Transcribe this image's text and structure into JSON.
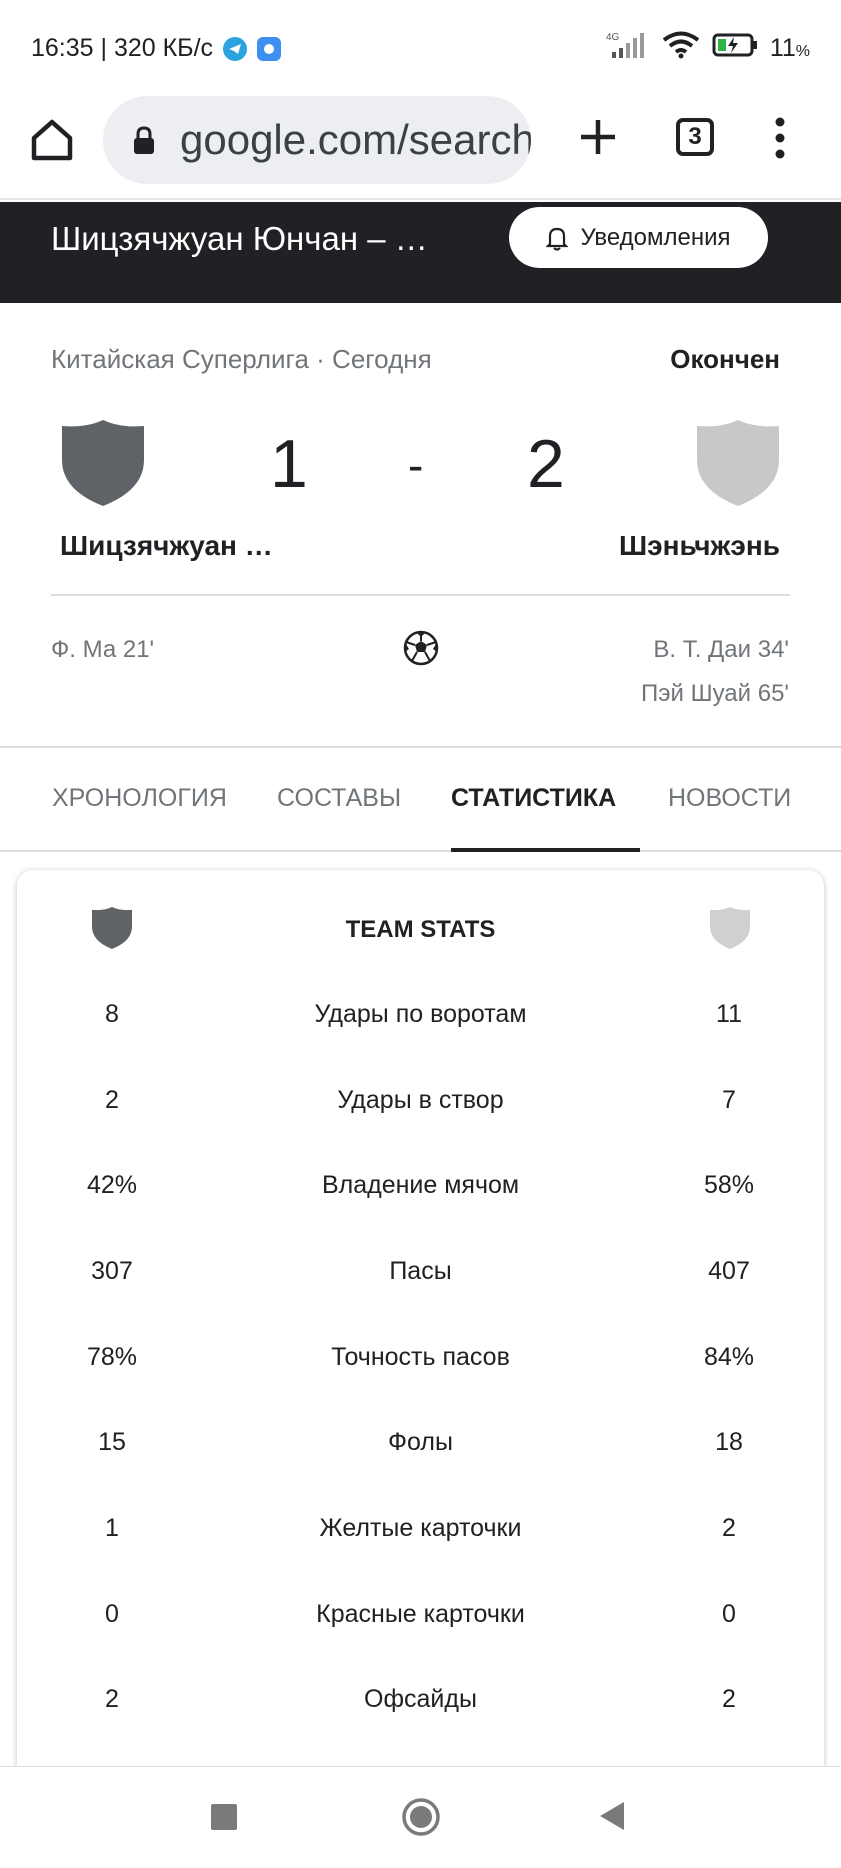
{
  "status_bar": {
    "time_speed": "16:35 | 320 КБ/с",
    "network": "4G",
    "battery": "11",
    "battery_unit": "%"
  },
  "browser": {
    "url": "google.com/search",
    "tab_count": "3"
  },
  "header": {
    "title": "Шицзячжуан Юнчан – …",
    "notify_label": "Уведомления"
  },
  "match": {
    "league": "Китайская Суперлига · Сегодня",
    "status": "Окончен",
    "home_team": "Шицзячжуан …",
    "away_team": "Шэньчжэнь",
    "home_score": "1",
    "separator": "-",
    "away_score": "2",
    "home_crest_color": "#5f6368",
    "away_crest_color": "#c8c8c8",
    "home_scorers": [
      "Ф. Ма 21'"
    ],
    "away_scorers": [
      "В. Т. Даи 34'",
      "Пэй Шуай 65'"
    ]
  },
  "tabs": [
    {
      "label": "ХРОНОЛОГИЯ",
      "active": false
    },
    {
      "label": "СОСТАВЫ",
      "active": false
    },
    {
      "label": "СТАТИСТИКА",
      "active": true
    },
    {
      "label": "НОВОСТИ",
      "active": false
    }
  ],
  "stats": {
    "title": "TEAM STATS",
    "rows": [
      {
        "home": "8",
        "label": "Удары по воротам",
        "away": "11"
      },
      {
        "home": "2",
        "label": "Удары в створ",
        "away": "7"
      },
      {
        "home": "42%",
        "label": "Владение мячом",
        "away": "58%"
      },
      {
        "home": "307",
        "label": "Пасы",
        "away": "407"
      },
      {
        "home": "78%",
        "label": "Точность пасов",
        "away": "84%"
      },
      {
        "home": "15",
        "label": "Фолы",
        "away": "18"
      },
      {
        "home": "1",
        "label": "Желтые карточки",
        "away": "2"
      },
      {
        "home": "0",
        "label": "Красные карточки",
        "away": "0"
      },
      {
        "home": "2",
        "label": "Офсайды",
        "away": "2"
      }
    ]
  }
}
